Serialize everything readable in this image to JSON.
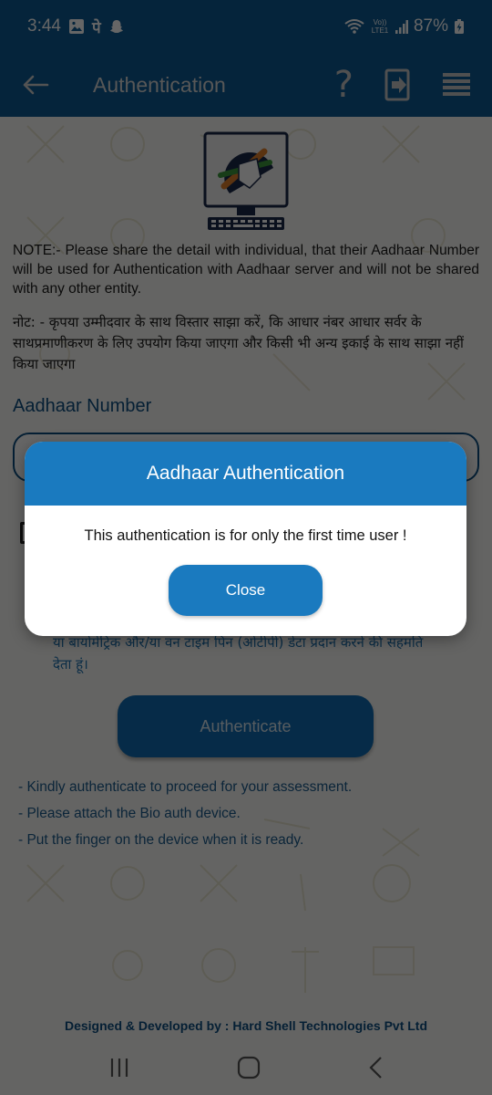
{
  "status_bar": {
    "time": "3:44",
    "left_icons": [
      "gallery-icon",
      "phonepe-icon",
      "snapchat-icon"
    ],
    "phonepe_glyph": "पे",
    "network_label": "Vo)) LTE1",
    "battery_percent": "87%",
    "right_icons": [
      "wifi-icon",
      "volte-icon",
      "signal-icon",
      "battery-charging-icon"
    ]
  },
  "app_bar": {
    "title": "Authentication",
    "back_icon": "arrow-left-icon",
    "help_glyph": "?",
    "actions": [
      "help-icon",
      "logout-icon",
      "menu-icon"
    ]
  },
  "content": {
    "note_en": "NOTE:- Please share the detail with individual, that their Aadhaar Number will be used for Authentication with Aadhaar server and will not be shared with any other entity.",
    "note_hi": "नोट: - कृपया उम्मीदवार के साथ विस्तार साझा करें, कि आधार नंबर आधार सर्वर के साथप्रमाणीकरण के लिए उपयोग किया जाएगा और किसी भी अन्य इकाई के साथ साझा नहीं किया जाएगा",
    "aadhaar_label": "Aadhaar Number",
    "aadhaar_value": "",
    "consent_checked": false,
    "consent_text_visible": "या बायोमेट्रिक और/या वन टाइम पिन (ओटीपी) डेटा प्रदान करने की सहमति देता हूं।",
    "authenticate_label": "Authenticate",
    "instructions": [
      "- Kindly authenticate to proceed for your assessment.",
      "- Please attach the Bio auth device.",
      "- Put the finger on the device when it is ready."
    ],
    "footer": "Designed & Developed by : Hard Shell Technologies Pvt Ltd"
  },
  "dialog": {
    "title": "Aadhaar Authentication",
    "message": "This authentication is for only the first time user !",
    "close_label": "Close"
  },
  "nav_bar": {
    "items": [
      "recent-apps-icon",
      "home-icon",
      "back-icon"
    ]
  },
  "colors": {
    "primary": "#0e5a94",
    "dialog_accent": "#1a7abf",
    "label_text": "#0d4f82"
  }
}
